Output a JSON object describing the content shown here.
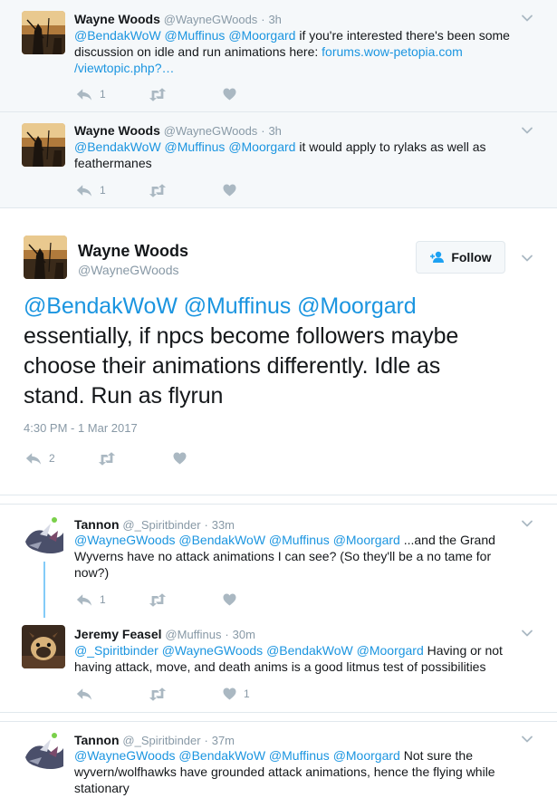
{
  "tweets_above": [
    {
      "name": "Wayne Woods",
      "handle": "@WayneGWoods",
      "sep": "·",
      "time": "3h",
      "mentions": [
        "@BendakWoW",
        "@Muffinus",
        "@Moorgard"
      ],
      "text": "if you're interested there's been some discussion on idle and run animations here:",
      "link": "forums.wow-petopia.com",
      "link2": "/viewtopic.php?…",
      "reply_count": "1"
    },
    {
      "name": "Wayne Woods",
      "handle": "@WayneGWoods",
      "sep": "·",
      "time": "3h",
      "mentions": [
        "@BendakWoW",
        "@Muffinus",
        "@Moorgard"
      ],
      "text": "it would apply to rylaks as well as feathermanes",
      "reply_count": "1"
    }
  ],
  "main_tweet": {
    "name": "Wayne Woods",
    "handle": "@WayneGWoods",
    "follow_label": "Follow",
    "mentions": [
      "@BendakWoW",
      "@Muffinus",
      "@Moorgard"
    ],
    "line1": "essentially, if npcs become followers maybe",
    "line2": "choose their animations differently. Idle as",
    "line3": "stand. Run as flyrun",
    "timestamp": "4:30 PM - 1 Mar 2017",
    "reply_count": "2"
  },
  "replies": [
    {
      "name": "Tannon",
      "handle": "@_Spiritbinder",
      "sep": "·",
      "time": "33m",
      "mentions": [
        "@WayneGWoods",
        "@BendakWoW",
        "@Muffinus",
        "@Moorgard"
      ],
      "text1": "...and the Grand",
      "text2": "Wyverns have no attack animations I can see? (So they'll be a no tame for",
      "text3": "now?)",
      "reply_count": "1"
    },
    {
      "name": "Jeremy Feasel",
      "handle": "@Muffinus",
      "sep": "·",
      "time": "30m",
      "mentions": [
        "@_Spiritbinder",
        "@WayneGWoods",
        "@BendakWoW",
        "@Moorgard"
      ],
      "text1": "Having or not",
      "text2": "having attack, move, and death anims is a good litmus test of possibilities",
      "like_count": "1"
    },
    {
      "name": "Tannon",
      "handle": "@_Spiritbinder",
      "sep": "·",
      "time": "37m",
      "mentions": [
        "@WayneGWoods",
        "@BendakWoW",
        "@Muffinus",
        "@Moorgard"
      ],
      "text1": "Not sure the",
      "text2": "wyvern/wolfhawks have grounded attack animations, hence the flying while",
      "text3": "stationary"
    }
  ],
  "icons": {
    "reply": "reply-icon",
    "retweet": "retweet-icon",
    "like": "heart-icon",
    "more": "chevron-down-icon",
    "follow": "add-user-icon"
  },
  "colors": {
    "link": "#1b95e0",
    "muted": "#8899a6",
    "icon": "#aab8c2",
    "ancestor_bg": "#f5f8fa",
    "thread_line": "#1da1f2"
  }
}
